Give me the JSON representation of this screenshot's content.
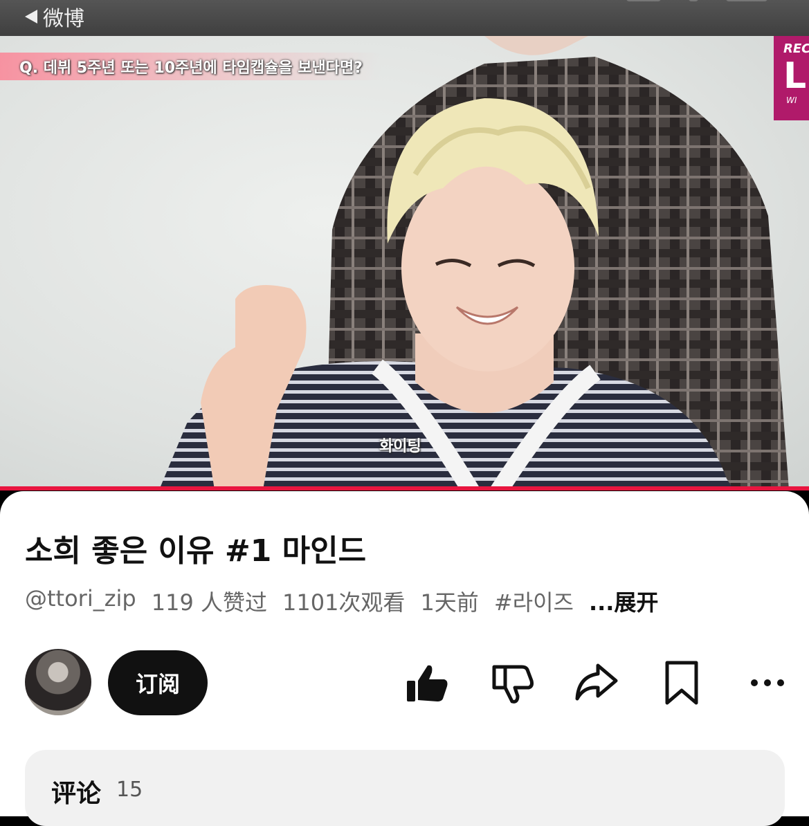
{
  "status_bar": {
    "back_app": "微博"
  },
  "video": {
    "subtitle_top": "Q. 데뷔 5주년 또는 10주년에 타임캡슐을 보낸다면?",
    "subtitle_bottom": "화이팅",
    "badge": {
      "line1": "REC",
      "line2": "L",
      "line3": "WI"
    },
    "progress_percent": 100
  },
  "post": {
    "title": "소희 좋은 이유 #1 마인드",
    "channel": "@ttori_zip",
    "likes": "119 人赞过",
    "views": "1101次观看",
    "time": "1天前",
    "hashtag": "#라이즈",
    "expand": "...展开"
  },
  "actions": {
    "subscribe_label": "订阅",
    "icons": [
      "thumbs-up-icon",
      "thumbs-down-icon",
      "share-icon",
      "bookmark-icon",
      "more-icon"
    ]
  },
  "comments": {
    "label": "评论",
    "count": "15"
  },
  "colors": {
    "progress": "#e8153f",
    "subscribe_bg": "#111111",
    "badge": "#b01a6a"
  }
}
